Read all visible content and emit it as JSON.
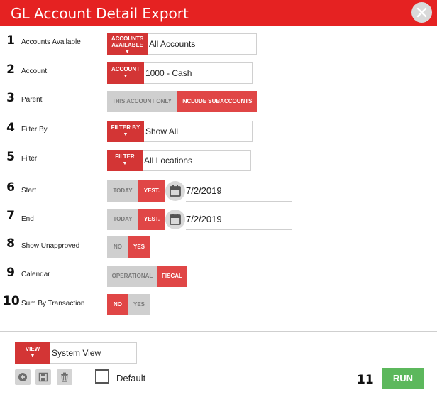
{
  "window": {
    "title": "GL Account Detail Export",
    "close_icon": "close-icon"
  },
  "rows": [
    {
      "num": "1",
      "label": "Accounts Available",
      "button": "ACCOUNTS AVAILABLE",
      "value": "All Accounts"
    },
    {
      "num": "2",
      "label": "Account",
      "button": "ACCOUNT",
      "value": "1000 - Cash"
    },
    {
      "num": "3",
      "label": "Parent",
      "options": [
        "THIS ACCOUNT ONLY",
        "INCLUDE SUBACCOUNTS"
      ],
      "selected": "INCLUDE SUBACCOUNTS"
    },
    {
      "num": "4",
      "label": "Filter By",
      "button": "FILTER BY",
      "value": "Show All"
    },
    {
      "num": "5",
      "label": "Filter",
      "button": "FILTER",
      "value": "All Locations"
    },
    {
      "num": "6",
      "label": "Start",
      "options": [
        "TODAY",
        "YEST."
      ],
      "selected": "YEST.",
      "date": "7/2/2019"
    },
    {
      "num": "7",
      "label": "End",
      "options": [
        "TODAY",
        "YEST."
      ],
      "selected": "YEST.",
      "date": "7/2/2019"
    },
    {
      "num": "8",
      "label": "Show Unapproved",
      "options": [
        "NO",
        "YES"
      ],
      "selected": "YES"
    },
    {
      "num": "9",
      "label": "Calendar",
      "options": [
        "OPERATIONAL",
        "FISCAL"
      ],
      "selected": "FISCAL"
    },
    {
      "num": "10",
      "label": "Sum By Transaction",
      "options": [
        "NO",
        "YES"
      ],
      "selected": "NO"
    }
  ],
  "view": {
    "button": "VIEW",
    "value": "System View"
  },
  "footer": {
    "default_label": "Default",
    "default_checked": false,
    "num": "11",
    "run_label": "RUN"
  },
  "colors": {
    "header": "#e52222",
    "accent": "#d33535",
    "toggle_on": "#e04646",
    "toggle_off": "#cfcfcf",
    "run": "#5cb85c"
  }
}
